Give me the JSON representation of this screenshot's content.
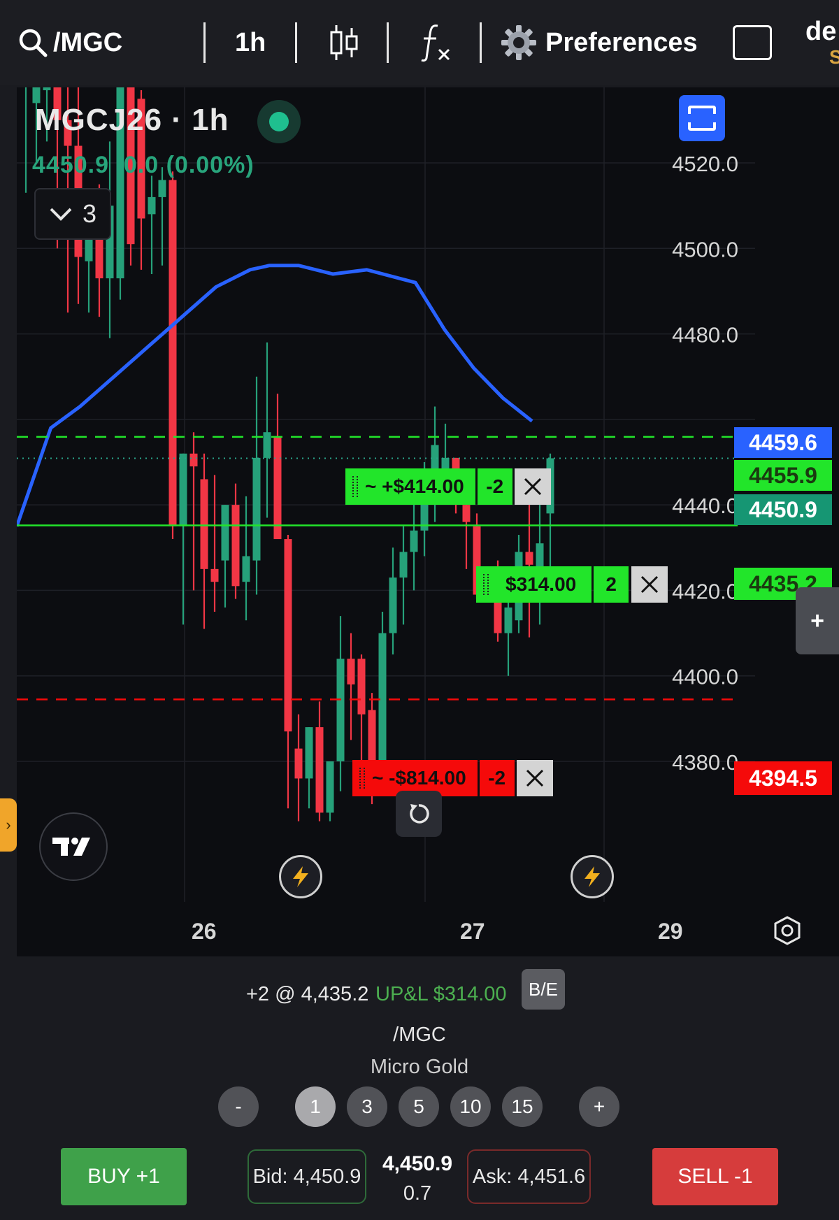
{
  "toolbar": {
    "symbol": "/MGC",
    "interval": "1h",
    "preferences_label": "Preferences",
    "account_text": "de",
    "account_sub": "S"
  },
  "chart_header": {
    "title": "MGCJ26 · 1h",
    "price_line": "4450.9  0.0 (0.00%)",
    "indicator_count": "3"
  },
  "price_axis": {
    "ticks": [
      "4520.0",
      "4500.0",
      "4480.0",
      "4440.0",
      "4420.0",
      "4400.0",
      "4380.0"
    ]
  },
  "price_tags": {
    "ma": "4459.6",
    "take_profit": "4455.9",
    "last": "4450.9",
    "entry": "4435.2",
    "stop_loss": "4394.5"
  },
  "orders": {
    "take_profit": {
      "pnl": "~ +$414.00",
      "qty": "-2"
    },
    "position": {
      "pnl": "$314.00",
      "qty": "2"
    },
    "stop_loss": {
      "pnl": "~ -$814.00",
      "qty": "-2"
    }
  },
  "time_axis": {
    "labels": [
      "26",
      "27",
      "29"
    ]
  },
  "panel": {
    "position_text": "+2 @ 4,435.2",
    "upl_text": "UP&L $314.00",
    "be_label": "B/E",
    "symbol": "/MGC",
    "instrument_name": "Micro Gold",
    "qty_minus": "-",
    "qty_plus": "+",
    "quantities": [
      "1",
      "3",
      "5",
      "10",
      "15"
    ],
    "buy_label": "BUY +1",
    "sell_label": "SELL -1",
    "bid": "Bid: 4,450.9",
    "ask": "Ask: 4,451.6",
    "last_price": "4,450.9",
    "last_change": "0.7"
  },
  "colors": {
    "up": "#26a17a",
    "down": "#f23645",
    "ma_line": "#2962ff",
    "take_profit_green": "#22e52a",
    "stop_red": "#f50a0a"
  },
  "chart_data": {
    "type": "candlestick",
    "y_range": [
      4373,
      4540
    ],
    "moving_average": {
      "x": [
        0,
        7,
        13,
        20,
        27,
        33,
        41,
        48,
        52,
        58,
        65,
        72,
        82,
        88,
        94,
        100,
        106
      ],
      "y": [
        4435,
        4458,
        4463,
        4470,
        4477,
        4483,
        4491,
        4495,
        4496,
        4496,
        4494,
        4495,
        4492,
        4481,
        4472,
        4465,
        4459.6
      ]
    },
    "candles": [
      {
        "o": 4538,
        "h": 4545,
        "l": 4513,
        "c": 4545
      },
      {
        "o": 4534,
        "h": 4540,
        "l": 4520,
        "c": 4538
      },
      {
        "o": 4537,
        "h": 4545,
        "l": 4525,
        "c": 4545
      },
      {
        "o": 4538,
        "h": 4545,
        "l": 4500,
        "c": 4530
      },
      {
        "o": 4530,
        "h": 4545,
        "l": 4485,
        "c": 4524
      },
      {
        "o": 4524,
        "h": 4540,
        "l": 4487,
        "c": 4498
      },
      {
        "o": 4497,
        "h": 4512,
        "l": 4485,
        "c": 4507
      },
      {
        "o": 4509,
        "h": 4515,
        "l": 4484,
        "c": 4493
      },
      {
        "o": 4493,
        "h": 4525,
        "l": 4479,
        "c": 4510
      },
      {
        "o": 4493,
        "h": 4525,
        "l": 4488,
        "c": 4538
      },
      {
        "o": 4538,
        "h": 4542,
        "l": 4496,
        "c": 4501
      },
      {
        "o": 4535,
        "h": 4537,
        "l": 4495,
        "c": 4507
      },
      {
        "o": 4508,
        "h": 4517,
        "l": 4494,
        "c": 4512
      },
      {
        "o": 4512,
        "h": 4519,
        "l": 4496,
        "c": 4516
      },
      {
        "o": 4516,
        "h": 4518,
        "l": 4432,
        "c": 4435
      },
      {
        "o": 4435,
        "h": 4452,
        "l": 4412,
        "c": 4452
      },
      {
        "o": 4452,
        "h": 4457,
        "l": 4420,
        "c": 4449
      },
      {
        "o": 4446,
        "h": 4452,
        "l": 4411,
        "c": 4425
      },
      {
        "o": 4425,
        "h": 4447,
        "l": 4415,
        "c": 4422
      },
      {
        "o": 4427,
        "h": 4440,
        "l": 4416,
        "c": 4440
      },
      {
        "o": 4440,
        "h": 4445,
        "l": 4418,
        "c": 4421
      },
      {
        "o": 4422,
        "h": 4442,
        "l": 4413,
        "c": 4428
      },
      {
        "o": 4427,
        "h": 4470,
        "l": 4419,
        "c": 4451
      },
      {
        "o": 4451,
        "h": 4478,
        "l": 4437,
        "c": 4457
      },
      {
        "o": 4456,
        "h": 4466,
        "l": 4432,
        "c": 4432
      },
      {
        "o": 4432,
        "h": 4433,
        "l": 4369,
        "c": 4387
      },
      {
        "o": 4383,
        "h": 4391,
        "l": 4366,
        "c": 4376
      },
      {
        "o": 4376,
        "h": 4388,
        "l": 4369,
        "c": 4388
      },
      {
        "o": 4388,
        "h": 4394,
        "l": 4366,
        "c": 4368
      },
      {
        "o": 4368,
        "h": 4380,
        "l": 4366,
        "c": 4380
      },
      {
        "o": 4380,
        "h": 4414,
        "l": 4373,
        "c": 4404
      },
      {
        "o": 4404,
        "h": 4410,
        "l": 4385,
        "c": 4398
      },
      {
        "o": 4404,
        "h": 4405,
        "l": 4380,
        "c": 4391
      },
      {
        "o": 4392,
        "h": 4396,
        "l": 4370,
        "c": 4372
      },
      {
        "o": 4375,
        "h": 4415,
        "l": 4374,
        "c": 4410
      },
      {
        "o": 4410,
        "h": 4430,
        "l": 4405,
        "c": 4423
      },
      {
        "o": 4423,
        "h": 4435,
        "l": 4412,
        "c": 4429
      },
      {
        "o": 4429,
        "h": 4441,
        "l": 4420,
        "c": 4434
      },
      {
        "o": 4434,
        "h": 4450,
        "l": 4428,
        "c": 4448
      },
      {
        "o": 4443,
        "h": 4463,
        "l": 4436,
        "c": 4454
      },
      {
        "o": 4448,
        "h": 4459,
        "l": 4446,
        "c": 4451
      },
      {
        "o": 4451,
        "h": 4451,
        "l": 4438,
        "c": 4441
      },
      {
        "o": 4440,
        "h": 4443,
        "l": 4425,
        "c": 4436
      },
      {
        "o": 4435,
        "h": 4438,
        "l": 4418,
        "c": 4419
      },
      {
        "o": 4419,
        "h": 4425,
        "l": 4418,
        "c": 4424
      },
      {
        "o": 4425,
        "h": 4427,
        "l": 4408,
        "c": 4410
      },
      {
        "o": 4410,
        "h": 4418,
        "l": 4400,
        "c": 4416
      },
      {
        "o": 4413,
        "h": 4433,
        "l": 4410,
        "c": 4429
      },
      {
        "o": 4429,
        "h": 4441,
        "l": 4409,
        "c": 4426
      },
      {
        "o": 4424,
        "h": 4447,
        "l": 4412,
        "c": 4431
      },
      {
        "o": 4438,
        "h": 4452,
        "l": 4425,
        "c": 4450.9
      }
    ]
  }
}
